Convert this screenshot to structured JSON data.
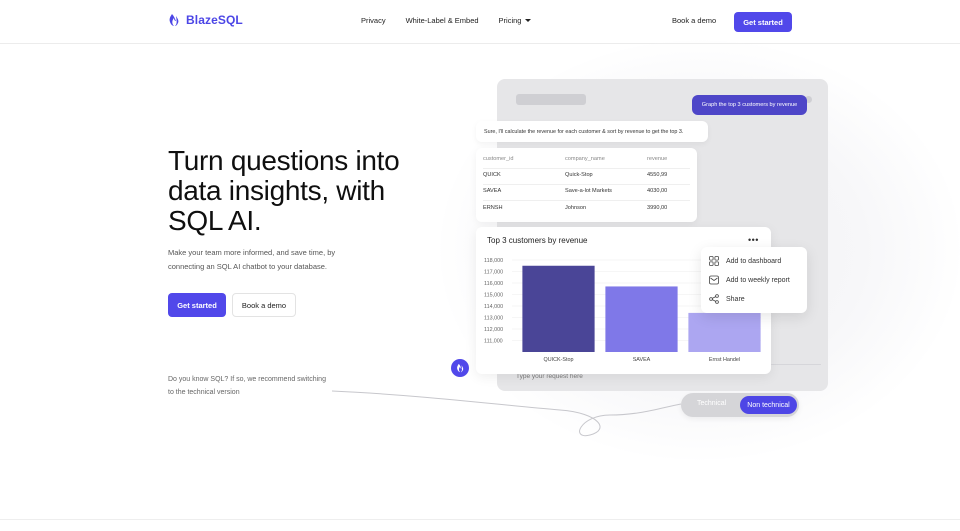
{
  "brand": {
    "name": "BlazeSQL",
    "accent": "#5148ea"
  },
  "nav": {
    "links": [
      {
        "label": "Privacy"
      },
      {
        "label": "White-Label & Embed"
      },
      {
        "label": "Pricing"
      }
    ],
    "book_demo": "Book a demo",
    "cta": "Get started"
  },
  "hero": {
    "title": "Turn questions into data insights, with SQL AI.",
    "subtitle": "Make your team more informed, and save time, by connecting an SQL AI chatbot to your database.",
    "primary_button": "Get started",
    "secondary_button": "Book a demo",
    "hint": "Do you know SQL? If so, we recommend switching to the technical version"
  },
  "demo": {
    "user_message": "Graph the top 3 customers by revenue",
    "ai_message": "Sure, I'll calculate the revenue for each customer & sort by revenue to get the top 3.",
    "table": {
      "headers": [
        "customer_id",
        "company_name",
        "revenue"
      ],
      "rows": [
        [
          "QUICK",
          "Quick-Stop",
          "4550,99"
        ],
        [
          "SAVEA",
          "Save-a-lot Markets",
          "4030,00"
        ],
        [
          "ERNSH",
          "Johnson",
          "3990,00"
        ]
      ]
    },
    "chart_title": "Top 3 customers by revenue",
    "menu": {
      "items": [
        {
          "label": "Add to dashboard",
          "icon": "dashboard-icon"
        },
        {
          "label": "Add to weekly report",
          "icon": "mail-icon"
        },
        {
          "label": "Share",
          "icon": "share-icon"
        }
      ]
    },
    "input_placeholder": "Type your request here",
    "toggle": {
      "off_label": "Technical",
      "on_label": "Non technical"
    }
  },
  "chart_data": {
    "type": "bar",
    "title": "Top 3 customers by revenue",
    "categories": [
      "QUICK-Stop",
      "SAVEA",
      "Ernst Handel"
    ],
    "values": [
      117500,
      115700,
      113400
    ],
    "colors": [
      "#4a4597",
      "#7f78e8",
      "#aca6f1"
    ],
    "ylim": [
      110000,
      118000
    ],
    "yticks": [
      "118,000",
      "117,000",
      "116,000",
      "115,000",
      "114,000",
      "113,000",
      "112,000",
      "111,000"
    ],
    "xlabel": "",
    "ylabel": "",
    "grid": true
  }
}
